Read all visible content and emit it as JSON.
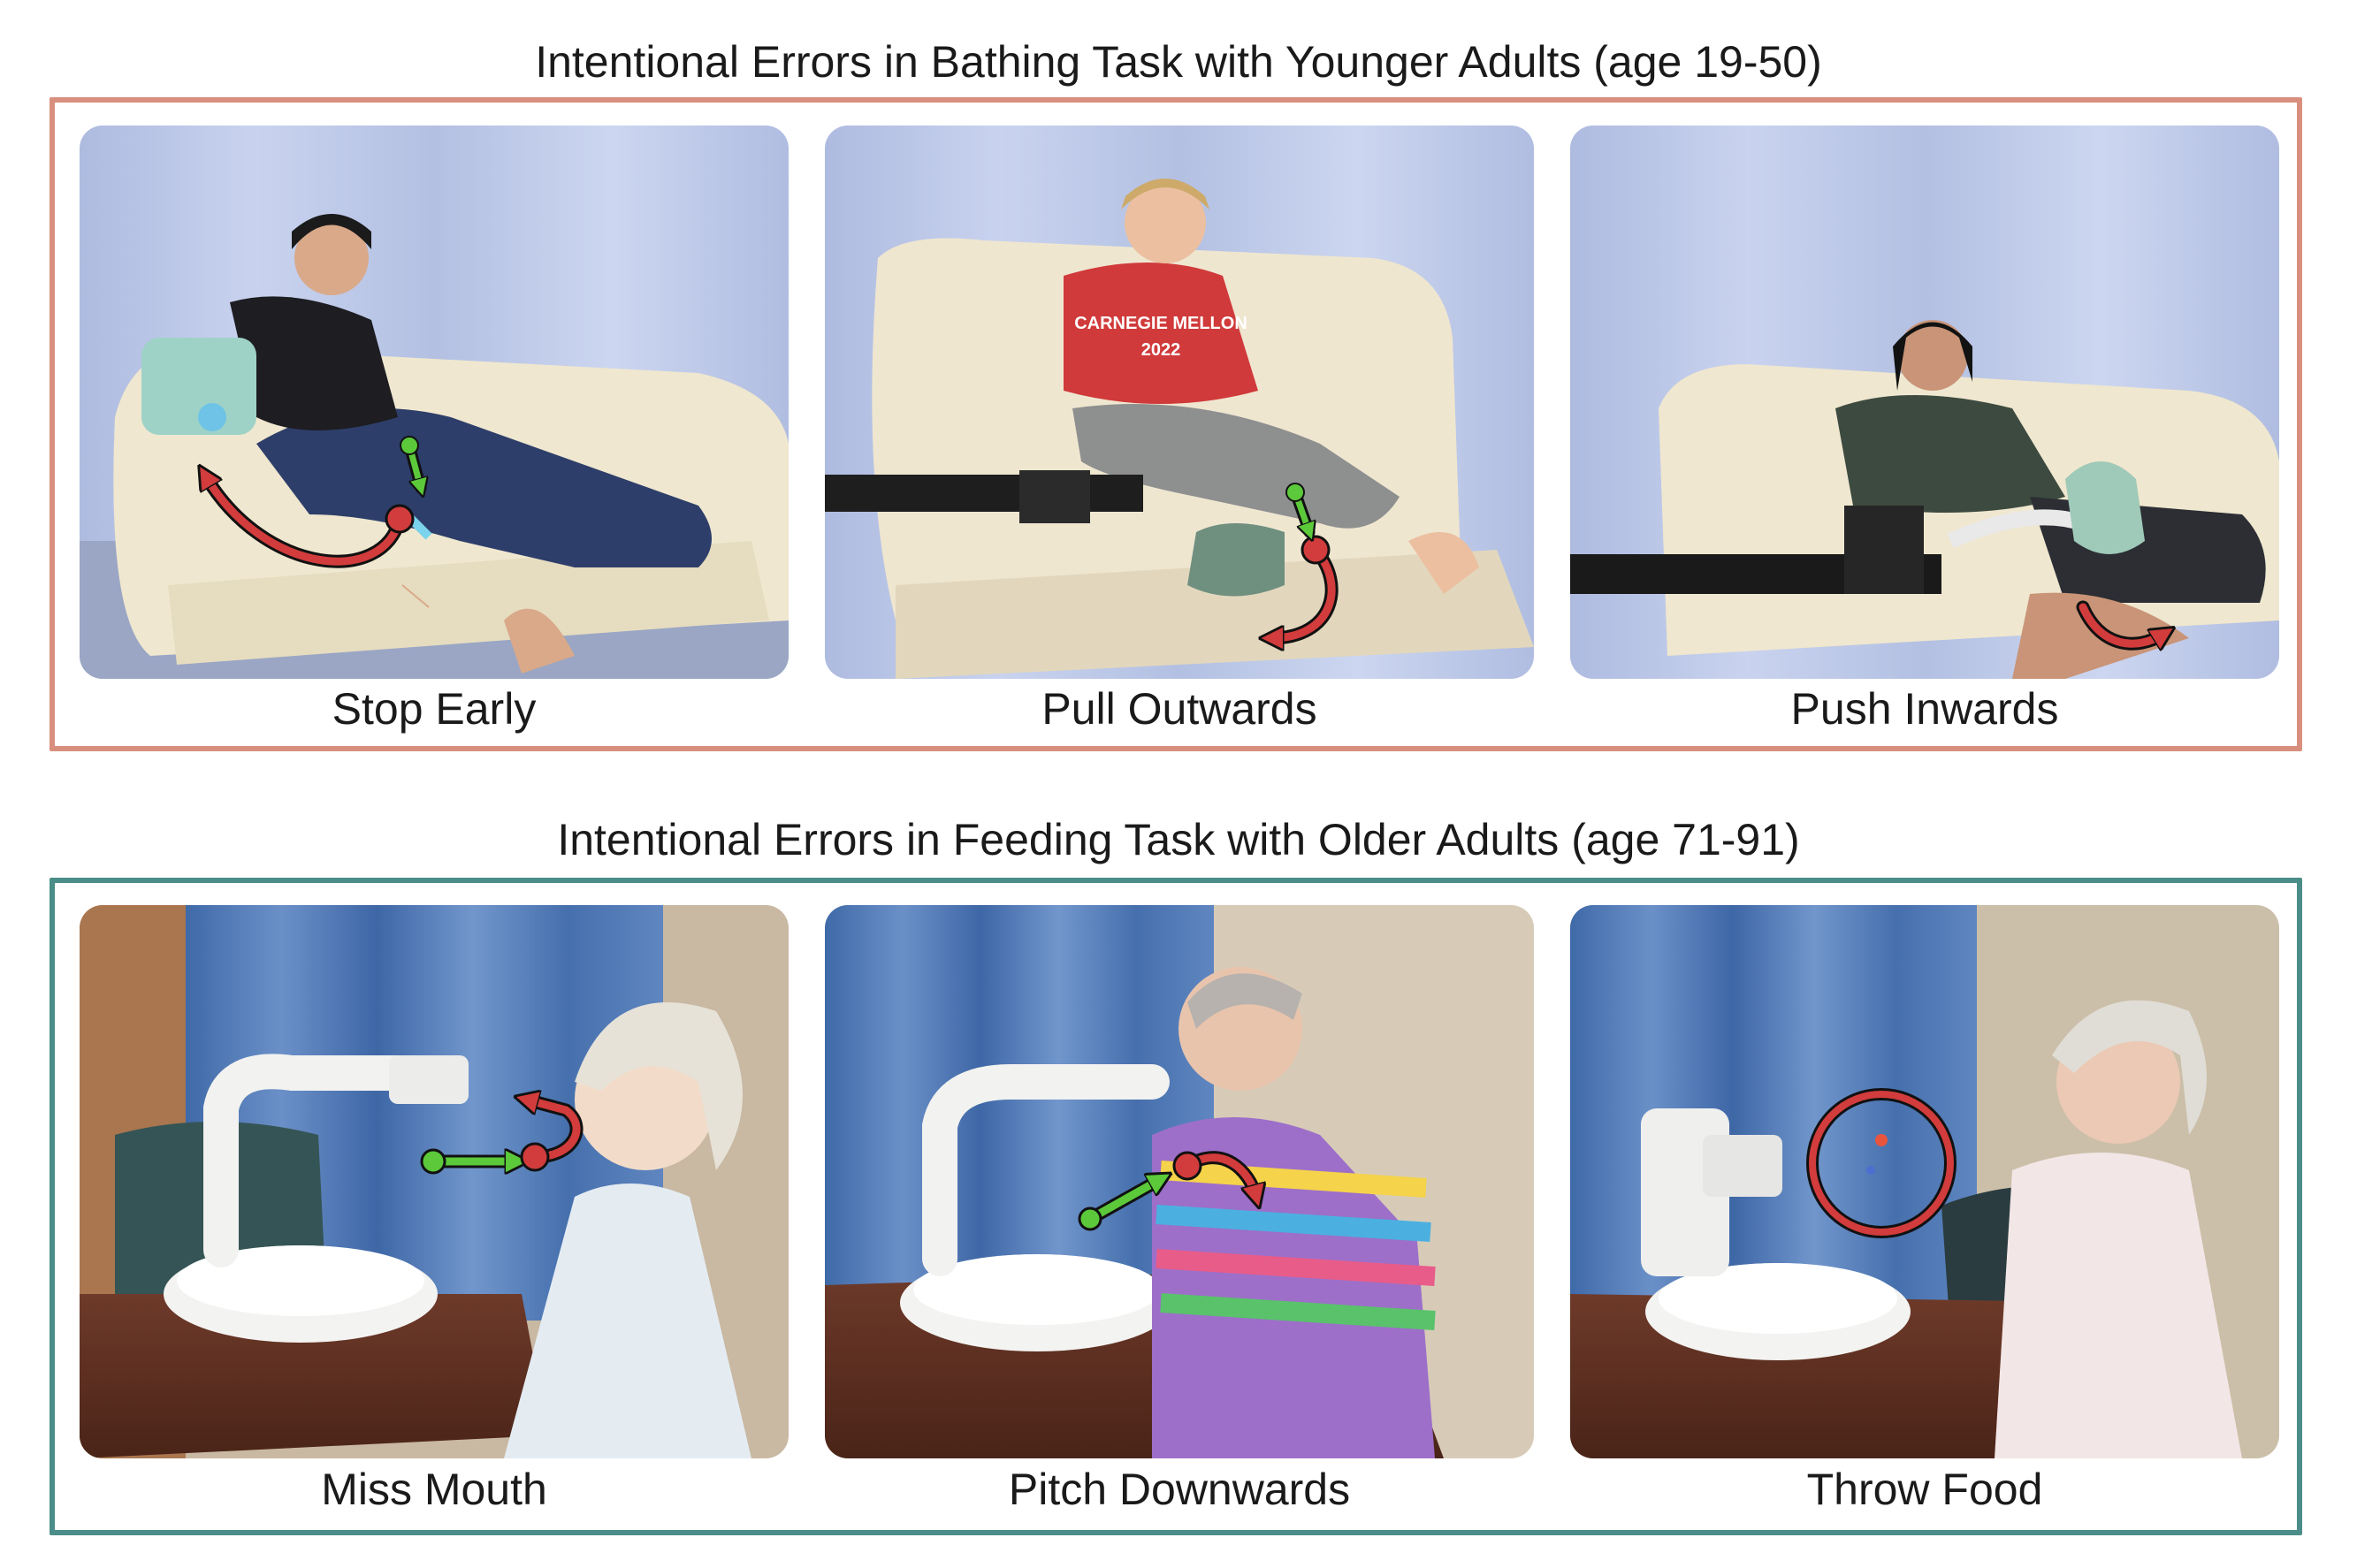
{
  "sections": [
    {
      "title": "Intentional Errors in Bathing Task with Younger Adults (age 19-50)",
      "border_color": "#d98f7e",
      "panels": [
        {
          "label": "Stop Early",
          "icon": "red-curved-arrow-icon"
        },
        {
          "label": "Pull Outwards",
          "icon": "red-curved-arrow-icon"
        },
        {
          "label": "Push Inwards",
          "icon": "red-curved-arrow-icon"
        }
      ]
    },
    {
      "title": "Intentional Errors in Feeding Task with Older Adults (age 71-91)",
      "border_color": "#4b8d88",
      "panels": [
        {
          "label": "Miss Mouth",
          "icon": "red-curved-arrow-icon"
        },
        {
          "label": "Pitch Downwards",
          "icon": "red-curved-arrow-icon"
        },
        {
          "label": "Throw Food",
          "icon": "red-circle-icon"
        }
      ]
    }
  ],
  "photo_text": {
    "shirt_brand": "CARNEGIE MELLON",
    "shirt_year": "2022"
  },
  "colors": {
    "correct_arrow": "#5cc93a",
    "error_arrow": "#d23c3c",
    "curtain": "#c3cde6",
    "feeding_curtain": "#5479b0"
  }
}
